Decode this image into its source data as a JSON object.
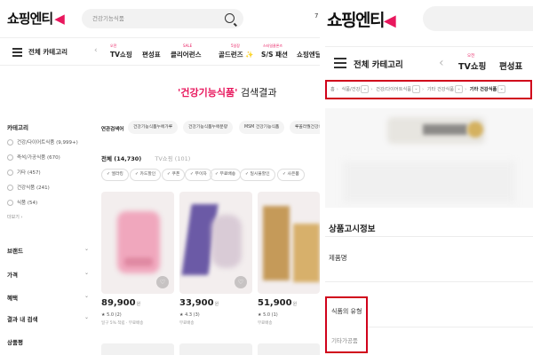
{
  "left": {
    "logo": "쇼핑엔티",
    "search_placeholder": "건강기능식품",
    "top_number": "7",
    "nav": {
      "all_categories": "전체 카테고리",
      "prev_arrow": "‹",
      "items": [
        {
          "label": "TV쇼핑",
          "sup": "오전"
        },
        {
          "label": "편성표",
          "sup": ""
        },
        {
          "label": "클리어런스",
          "sup": "SALE"
        },
        {
          "label": "골드런즈 ✨",
          "sup": "5일장"
        },
        {
          "label": "S/S 패션",
          "sup": "스타일클론즈"
        },
        {
          "label": "쇼핑엔딜",
          "sup": ""
        }
      ]
    },
    "result_title": {
      "keyword": "'건강기능식품'",
      "suffix": " 검색결과"
    },
    "sidebar": {
      "category_heading": "카테고리",
      "categories": [
        {
          "label": "건강/다이어트식품 (9,999+)"
        },
        {
          "label": "즉석/가공식품 (670)"
        },
        {
          "label": "기타 (457)"
        },
        {
          "label": "건강식품 (241)"
        },
        {
          "label": "식품 (54)"
        }
      ],
      "more": "더보기 ›",
      "sections": [
        {
          "label": "브랜드",
          "chevron": "⌄"
        },
        {
          "label": "가격",
          "chevron": "⌄"
        },
        {
          "label": "혜택",
          "chevron": "⌄"
        },
        {
          "label": "결과 내 검색",
          "chevron": "⌄"
        },
        {
          "label": "상품평",
          "chevron": ""
        }
      ]
    },
    "related": {
      "label": "연관검색어",
      "chips": [
        "건강기능식품누에가루",
        "건강기능식품누애분량",
        "MSM 건강기능식품",
        "루꼴라월건강식"
      ]
    },
    "tabs": {
      "all": "전체 (14,730)",
      "tv": "TV쇼핑 (101)"
    },
    "filters": [
      "✓ 엘라킹",
      "✓ 카드할인",
      "✓ 쿠폰",
      "✓ 무이자",
      "✓ 무료배송",
      "✓ 일시불할인",
      "✓ 사은품"
    ],
    "products": [
      {
        "price": "89,900",
        "unit": "원",
        "rating": "★ 5.0 (2)",
        "meta": "일구 5% 적립 · 무료배송"
      },
      {
        "price": "33,900",
        "unit": "원",
        "rating": "★ 4.3 (3)",
        "meta": "무료배송"
      },
      {
        "price": "51,900",
        "unit": "원",
        "rating": "★ 5.0 (1)",
        "meta": "무료배송"
      }
    ],
    "heart_icon": "♡"
  },
  "right": {
    "logo": "쇼핑엔티",
    "nav": {
      "all_categories": "전체 카테고리",
      "prev_arrow": "‹",
      "items": [
        {
          "label": "TV쇼핑",
          "sup": "오전"
        },
        {
          "label": "편성표",
          "sup": ""
        }
      ]
    },
    "breadcrumb": {
      "home": "홈",
      "items": [
        "식품/건강",
        "건강/다이어트식품",
        "기타 건강식품",
        "기타 건강식품"
      ]
    },
    "spec": {
      "title": "상품고시정보",
      "row1_label": "제품명",
      "row2_label": "식품의 유형",
      "row2_value": "기타가공품"
    }
  },
  "colors": {
    "brand_pink": "#e8175d",
    "highlight_red": "#d0021b"
  }
}
